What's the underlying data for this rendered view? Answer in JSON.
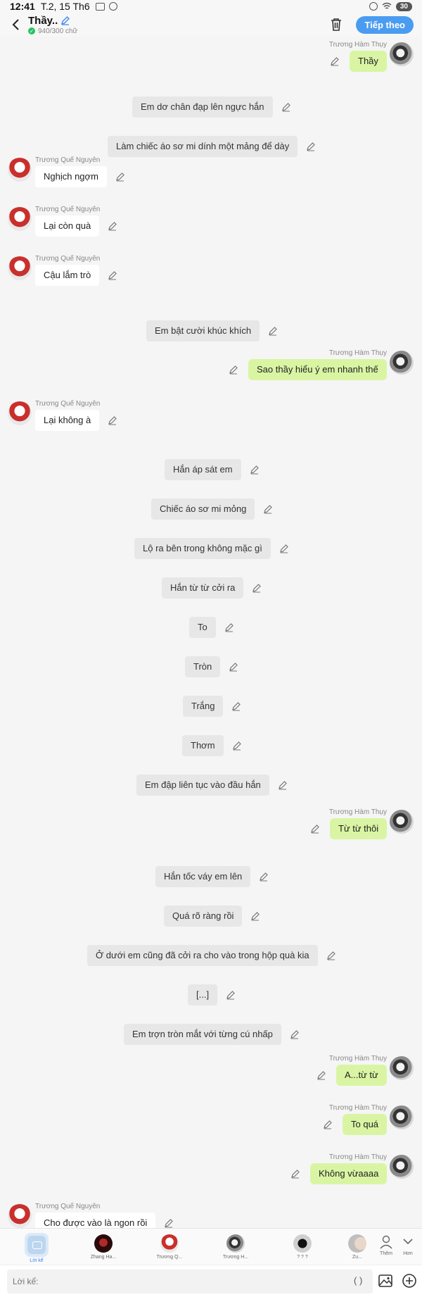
{
  "status_bar": {
    "time": "12:41",
    "date": "T.2, 15 Th6",
    "battery": "30"
  },
  "header": {
    "title": "Thầy..",
    "word_count": "940/300 chữ",
    "next_label": "Tiếp theo"
  },
  "characters": {
    "teacher": "Trương Hàm Thụy",
    "student": "Trương Quế Nguyên"
  },
  "messages": [
    {
      "type": "right",
      "text": "Thầy"
    },
    {
      "type": "narr",
      "text": "Em dơ chân đạp lên ngực hắn"
    },
    {
      "type": "narr",
      "text": "Làm chiếc áo sơ mi dính một mảng để dày"
    },
    {
      "type": "left",
      "text": "Nghịch ngợm"
    },
    {
      "type": "left",
      "text": "Lại còn quà"
    },
    {
      "type": "left",
      "text": "Cậu lắm trò"
    },
    {
      "type": "narr",
      "text": "Em bật cười khúc khích"
    },
    {
      "type": "right",
      "text": "Sao thầy hiểu ý em nhanh thế"
    },
    {
      "type": "left",
      "text": "Lại không à"
    },
    {
      "type": "narr",
      "text": "Hắn áp sát em"
    },
    {
      "type": "narr",
      "text": "Chiếc áo sơ mi mỏng"
    },
    {
      "type": "narr",
      "text": "Lộ ra bên trong không mặc gì"
    },
    {
      "type": "narr",
      "text": "Hắn từ từ cởi ra"
    },
    {
      "type": "narr",
      "text": "To"
    },
    {
      "type": "narr",
      "text": "Tròn"
    },
    {
      "type": "narr",
      "text": "Trắng"
    },
    {
      "type": "narr",
      "text": "Thơm"
    },
    {
      "type": "narr",
      "text": "Em đập liên tục vào đầu hắn"
    },
    {
      "type": "right",
      "text": "Từ từ thôi"
    },
    {
      "type": "narr",
      "text": "Hắn tốc váy em lên"
    },
    {
      "type": "narr",
      "text": "Quá rõ ràng rồi"
    },
    {
      "type": "narr",
      "text": "Ở dưới em cũng đã cởi ra cho vào trong hộp quà kia"
    },
    {
      "type": "narr",
      "text": "[...]"
    },
    {
      "type": "narr",
      "text": "Em trợn tròn mắt với từng cú nhấp"
    },
    {
      "type": "right",
      "text": "A...từ từ"
    },
    {
      "type": "right",
      "text": "To quá"
    },
    {
      "type": "right",
      "text": "Không vừaaaa"
    },
    {
      "type": "left",
      "text": "Cho được vào là ngon rồi"
    }
  ],
  "char_bar": {
    "items": [
      {
        "label": "Lời kể",
        "icon": "narration-icon"
      },
      {
        "label": "Zhang Ha..."
      },
      {
        "label": "Trương Q..."
      },
      {
        "label": "Trương H..."
      },
      {
        "label": "? ? ?"
      },
      {
        "label": "Zu..."
      }
    ],
    "more_label": "Thêm",
    "collapse_label": "Hơn"
  },
  "input": {
    "placeholder": "Lời kể:",
    "paren": "( )"
  },
  "colors": {
    "accent": "#4a9cf0",
    "user_bubble": "#d9f5a3",
    "narration": "#e7e7e7"
  }
}
